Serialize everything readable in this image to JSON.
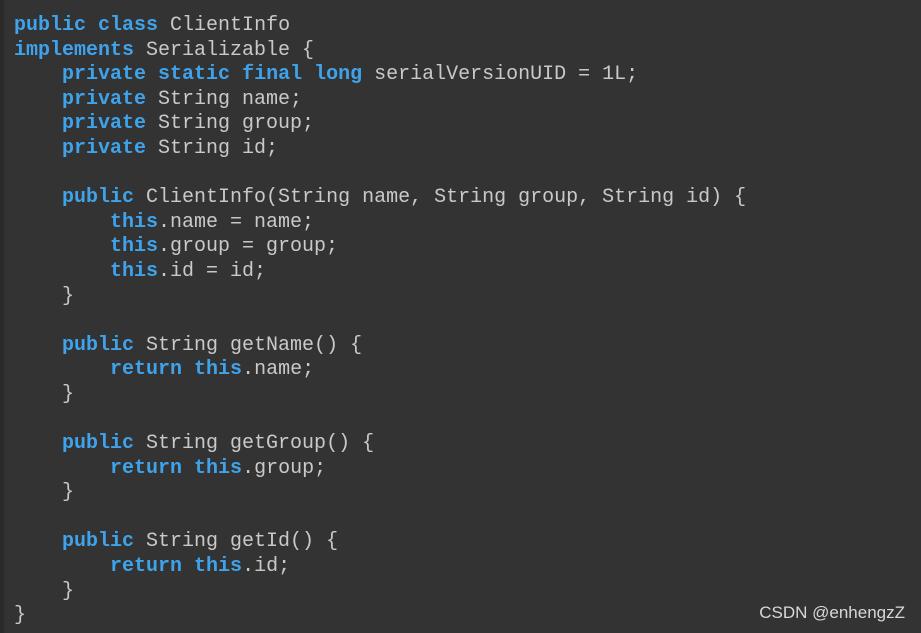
{
  "colors": {
    "background": "#333333",
    "keyword": "#3fa3ec",
    "text": "#c9c9c9"
  },
  "code_lines": [
    [
      [
        "kw",
        "public"
      ],
      [
        "t",
        " "
      ],
      [
        "kw",
        "class"
      ],
      [
        "t",
        " ClientInfo"
      ]
    ],
    [
      [
        "kw",
        "implements"
      ],
      [
        "t",
        " Serializable {"
      ]
    ],
    [
      [
        "t",
        "    "
      ],
      [
        "kw",
        "private"
      ],
      [
        "t",
        " "
      ],
      [
        "kw",
        "static"
      ],
      [
        "t",
        " "
      ],
      [
        "kw",
        "final"
      ],
      [
        "t",
        " "
      ],
      [
        "kw",
        "long"
      ],
      [
        "t",
        " serialVersionUID = 1L;"
      ]
    ],
    [
      [
        "t",
        "    "
      ],
      [
        "kw",
        "private"
      ],
      [
        "t",
        " String name;"
      ]
    ],
    [
      [
        "t",
        "    "
      ],
      [
        "kw",
        "private"
      ],
      [
        "t",
        " String group;"
      ]
    ],
    [
      [
        "t",
        "    "
      ],
      [
        "kw",
        "private"
      ],
      [
        "t",
        " String id;"
      ]
    ],
    [],
    [
      [
        "t",
        "    "
      ],
      [
        "kw",
        "public"
      ],
      [
        "t",
        " ClientInfo(String name, String group, String id) {"
      ]
    ],
    [
      [
        "t",
        "        "
      ],
      [
        "kw",
        "this"
      ],
      [
        "t",
        ".name = name;"
      ]
    ],
    [
      [
        "t",
        "        "
      ],
      [
        "kw",
        "this"
      ],
      [
        "t",
        ".group = group;"
      ]
    ],
    [
      [
        "t",
        "        "
      ],
      [
        "kw",
        "this"
      ],
      [
        "t",
        ".id = id;"
      ]
    ],
    [
      [
        "t",
        "    }"
      ]
    ],
    [],
    [
      [
        "t",
        "    "
      ],
      [
        "kw",
        "public"
      ],
      [
        "t",
        " String getName() {"
      ]
    ],
    [
      [
        "t",
        "        "
      ],
      [
        "kw",
        "return"
      ],
      [
        "t",
        " "
      ],
      [
        "kw",
        "this"
      ],
      [
        "t",
        ".name;"
      ]
    ],
    [
      [
        "t",
        "    }"
      ]
    ],
    [],
    [
      [
        "t",
        "    "
      ],
      [
        "kw",
        "public"
      ],
      [
        "t",
        " String getGroup() {"
      ]
    ],
    [
      [
        "t",
        "        "
      ],
      [
        "kw",
        "return"
      ],
      [
        "t",
        " "
      ],
      [
        "kw",
        "this"
      ],
      [
        "t",
        ".group;"
      ]
    ],
    [
      [
        "t",
        "    }"
      ]
    ],
    [],
    [
      [
        "t",
        "    "
      ],
      [
        "kw",
        "public"
      ],
      [
        "t",
        " String getId() {"
      ]
    ],
    [
      [
        "t",
        "        "
      ],
      [
        "kw",
        "return"
      ],
      [
        "t",
        " "
      ],
      [
        "kw",
        "this"
      ],
      [
        "t",
        ".id;"
      ]
    ],
    [
      [
        "t",
        "    }"
      ]
    ],
    [
      [
        "t",
        "}"
      ]
    ]
  ],
  "watermark": "CSDN @enhengzZ"
}
